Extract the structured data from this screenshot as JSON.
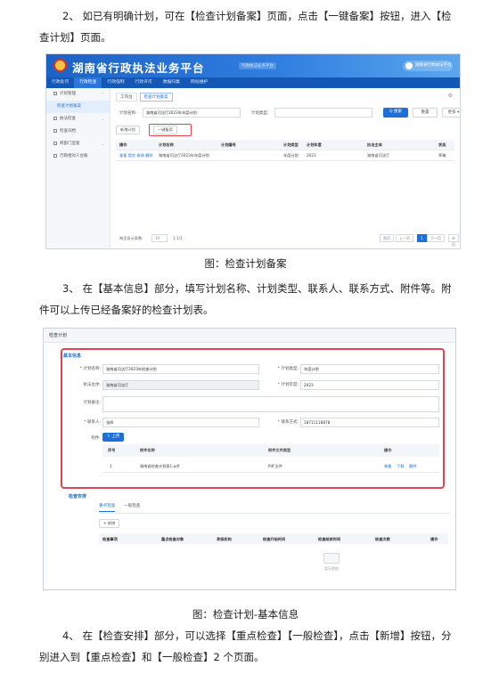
{
  "doc": {
    "step2": "2、 如已有明确计划，可在【检查计划备案】页面，点击【一键备案】按钮，进入【检查计划】页面。",
    "caption1": "图：检查计划备案",
    "step3": "3、 在【基本信息】部分，填写计划名称、计划类型、联系人、联系方式、附件等。附件可以上传已经备案好的检查计划表。",
    "caption2": "图：检查计划-基本信息",
    "step4": "4、 在【检查安排】部分，可以选择【重点检查】【一般检查】，点击【新增】按钮，分别进入到【重点检查】和【一般检查】2 个页面。"
  },
  "shot1": {
    "app_title": "湖南省行政执法业务平台",
    "title_badge": "行政执法业务平台",
    "user": "湖南省行政执法平台",
    "nav": [
      "行政处罚",
      "行政检查",
      "行政强制",
      "行政许可",
      "数据归集",
      "网站维护"
    ],
    "sidebar": [
      {
        "label": "计划管理",
        "child": false
      },
      {
        "label": "检查计划备案",
        "child": true
      },
      {
        "label": "执法检查",
        "child": false
      },
      {
        "label": "检查归档",
        "child": false
      },
      {
        "label": "跨部门监管",
        "child": false
      },
      {
        "label": "行政相对人台账",
        "child": false
      }
    ],
    "tabs": [
      "工作台",
      "检查计划备案"
    ],
    "filter": {
      "name_label": "计划名称:",
      "name_value": "湖南省司法厅2023年年度计划",
      "type_label": "计划类型:",
      "search": "Q 搜索",
      "reset": "重置",
      "more": "更多 ▾"
    },
    "actions": {
      "new": "新增计划",
      "one_click": "一键备案"
    },
    "columns": [
      "操作",
      "计划名称",
      "计划编号",
      "计划类型",
      "计划年度",
      "执法主体",
      "状态"
    ],
    "row": {
      "ops": "查看 提交 修改 删除",
      "name": "湖南省司法厅2023年年度计划",
      "code": "",
      "type": "年度计划",
      "year": "2023",
      "subject": "湖南省司法厅",
      "status": "草稿"
    },
    "pager": {
      "per_page_label": "每页显示条数:",
      "per_page": "10",
      "range": "1-1/1",
      "first": "首页",
      "prev": "上一页",
      "current": "1",
      "next": "下一页",
      "last": "末页"
    }
  },
  "shot2": {
    "header": "检查计划",
    "basic_title": "基本信息",
    "plan_name_label": "* 计划名称:",
    "plan_name": "湖南省司法厅2023年检查计划",
    "plan_type_label": "* 计划类型:",
    "plan_type": "年度计划",
    "subject_label": "执法主体:",
    "subject": "湖南省司法厅",
    "plan_year_label": "* 计划年度:",
    "plan_year": "2023",
    "remark_label": "计划备注:",
    "contact_label": "* 联系人:",
    "contact": "张晖",
    "phone_label": "* 联系方式:",
    "phone": "18711118878",
    "attach_label": "附件:",
    "upload": "⇧ 上传",
    "attach_cols": [
      "序号",
      "附件名称",
      "附件文件类型",
      "操作"
    ],
    "attach_row": {
      "no": "1",
      "name": "湖南省检查计划表1.pdf",
      "type": "PdF文件",
      "view": "查看",
      "download": "下载",
      "delete": "删除"
    },
    "arrange_title": "检查安排",
    "arrange_tabs": [
      "重点检查",
      "一般检查"
    ],
    "add": "+ 新增",
    "arrange_cols": [
      "检查事项",
      "重点检查对象",
      "承担机构",
      "检查开始时间",
      "检查结束时间",
      "检查次数",
      "操作"
    ],
    "empty": "暂无数据"
  }
}
